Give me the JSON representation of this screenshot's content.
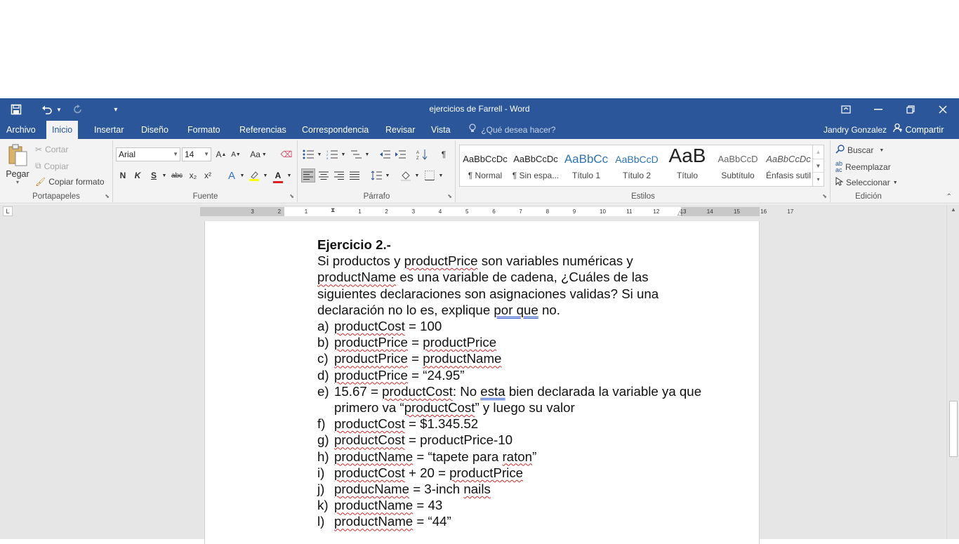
{
  "window": {
    "title": "ejercicios de Farrell - Word",
    "controls": {
      "ribbon_display": "▣",
      "minimize": "—",
      "restore": "❐",
      "close": "✕"
    }
  },
  "qat": {
    "save": "💾",
    "undo": "↶",
    "redo": "↻",
    "customize": "≡"
  },
  "tabs": [
    "Archivo",
    "Inicio",
    "Insertar",
    "Diseño",
    "Formato",
    "Referencias",
    "Correspondencia",
    "Revisar",
    "Vista"
  ],
  "tell_me": "¿Qué desea hacer?",
  "user": "Jandry Gonzalez",
  "share": "Compartir",
  "clipboard": {
    "paste": "Pegar",
    "cut": "Cortar",
    "copy": "Copiar",
    "format_painter": "Copiar formato",
    "label": "Portapapeles"
  },
  "font": {
    "name": "Arial",
    "size": "14",
    "bold": "N",
    "italic": "K",
    "underline": "S",
    "strike": "abc",
    "sub": "x₂",
    "sup": "x²",
    "case": "Aa",
    "grow": "A",
    "shrink": "A",
    "color": "A",
    "label": "Fuente"
  },
  "paragraph": {
    "label": "Párrafo",
    "pilcrow": "¶"
  },
  "styles": {
    "label": "Estilos",
    "items": [
      {
        "preview": "AaBbCcDc",
        "name": "¶ Normal"
      },
      {
        "preview": "AaBbCcDc",
        "name": "¶ Sin espa..."
      },
      {
        "preview": "AaBbCc",
        "name": "Título 1"
      },
      {
        "preview": "AaBbCcD",
        "name": "Título 2"
      },
      {
        "preview": "AaB",
        "name": "Título"
      },
      {
        "preview": "AaBbCcD",
        "name": "Subtítulo"
      },
      {
        "preview": "AaBbCcDc",
        "name": "Énfasis sutil"
      }
    ]
  },
  "editing": {
    "find": "Buscar",
    "replace": "Reemplazar",
    "select": "Seleccionar",
    "label": "Edición"
  },
  "ruler": {
    "numbers": [
      "3",
      "2",
      "1",
      "1",
      "2",
      "3",
      "4",
      "5",
      "6",
      "7",
      "8",
      "9",
      "10",
      "11",
      "12",
      "13",
      "14",
      "15",
      "16",
      "17"
    ]
  },
  "document": {
    "heading": "Ejercicio 2.-",
    "intro": {
      "l1_a": "Si productos y ",
      "l1_b": "productPrice",
      "l1_c": " son variables numéricas y",
      "l2_a": "productName",
      "l2_b": " es una variable de cadena, ¿Cuáles de las",
      "l3": "siguientes declaraciones son asignaciones validas? Si una",
      "l4_a": "declaración no lo es, explique ",
      "l4_b": "por que",
      "l4_c": " no."
    },
    "items": [
      {
        "label": "a)",
        "parts": [
          {
            "t": "productCost",
            "s": 1
          },
          {
            "t": " = 100",
            "s": 0
          }
        ]
      },
      {
        "label": "b)",
        "parts": [
          {
            "t": "productPrice",
            "s": 1
          },
          {
            "t": " = ",
            "s": 0
          },
          {
            "t": "productPrice",
            "s": 1
          }
        ]
      },
      {
        "label": "c)",
        "parts": [
          {
            "t": "productPrice",
            "s": 1
          },
          {
            "t": " = ",
            "s": 0
          },
          {
            "t": "productName",
            "s": 1
          }
        ]
      },
      {
        "label": "d)",
        "parts": [
          {
            "t": "productPrice",
            "s": 1
          },
          {
            "t": " = “24.95”",
            "s": 0
          }
        ]
      },
      {
        "label": "e)",
        "parts": [
          {
            "t": "15.67 = ",
            "s": 0
          },
          {
            "t": "productCost",
            "s": 1
          },
          {
            "t": ": No ",
            "s": 0
          },
          {
            "t": "esta",
            "s": 2
          },
          {
            "t": " bien declarada la variable ya que primero va “",
            "s": 0
          },
          {
            "t": "productCost",
            "s": 1
          },
          {
            "t": "” y luego su valor",
            "s": 0
          }
        ]
      },
      {
        "label": "f)",
        "parts": [
          {
            "t": "productCost",
            "s": 1
          },
          {
            "t": " = $1.345.52",
            "s": 0
          }
        ]
      },
      {
        "label": "g)",
        "parts": [
          {
            "t": "productCost",
            "s": 1
          },
          {
            "t": " = productPrice-10",
            "s": 0
          }
        ]
      },
      {
        "label": "h)",
        "parts": [
          {
            "t": "productName",
            "s": 1
          },
          {
            "t": " = “tapete para ",
            "s": 0
          },
          {
            "t": "raton",
            "s": 1
          },
          {
            "t": "”",
            "s": 0
          }
        ]
      },
      {
        "label": "i)",
        "parts": [
          {
            "t": "productCost",
            "s": 1
          },
          {
            "t": " + 20 = ",
            "s": 0
          },
          {
            "t": "productPrice",
            "s": 1
          }
        ]
      },
      {
        "label": "j)",
        "parts": [
          {
            "t": "producName",
            "s": 1
          },
          {
            "t": " = 3-inch ",
            "s": 0
          },
          {
            "t": "nails",
            "s": 1
          }
        ]
      },
      {
        "label": "k)",
        "parts": [
          {
            "t": "productName",
            "s": 1
          },
          {
            "t": " = 43",
            "s": 0
          }
        ]
      },
      {
        "label": "l)",
        "parts": [
          {
            "t": "productName",
            "s": 1
          },
          {
            "t": " = “44”",
            "s": 0
          }
        ]
      }
    ]
  }
}
